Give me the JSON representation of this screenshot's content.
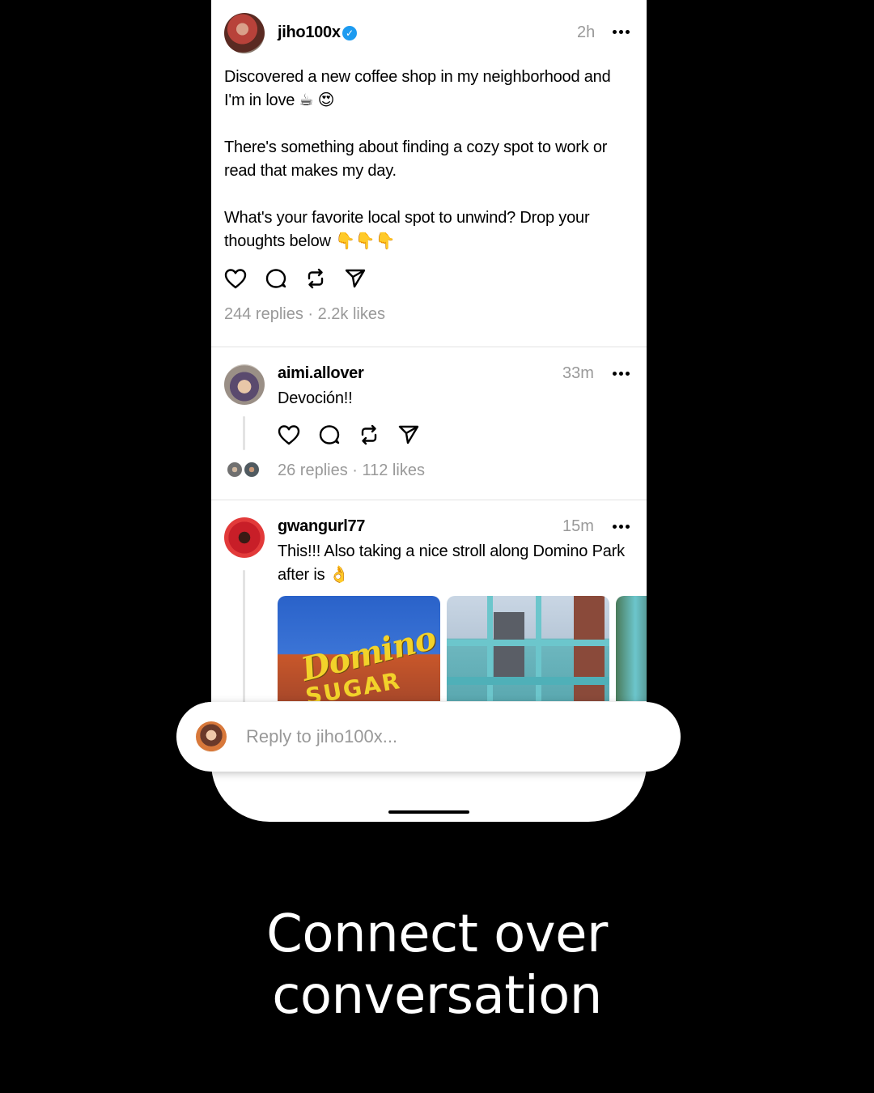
{
  "post": {
    "username": "jiho100x",
    "verified_icon": "verified-badge-icon",
    "time": "2h",
    "paragraphs": [
      "Discovered a new coffee shop in my neighborhood and I'm in love ☕ 😍",
      "There's something about finding a cozy spot to work or read that makes my day.",
      "What's your favorite local spot to unwind? Drop your thoughts below 👇👇👇"
    ],
    "stats": "244 replies · 2.2k likes"
  },
  "reply1": {
    "username": "aimi.allover",
    "time": "33m",
    "text": "Devoción!!",
    "stats": "26 replies · 112 likes"
  },
  "reply2": {
    "username": "gwangurl77",
    "time": "15m",
    "text": "This!!! Also taking a nice stroll along Domino Park after is 👌",
    "image_sign_1": "Domino",
    "image_sign_2": "SUGAR"
  },
  "composer": {
    "placeholder": "Reply to jiho100x..."
  },
  "tagline": {
    "line1": "Connect over",
    "line2": "conversation"
  }
}
